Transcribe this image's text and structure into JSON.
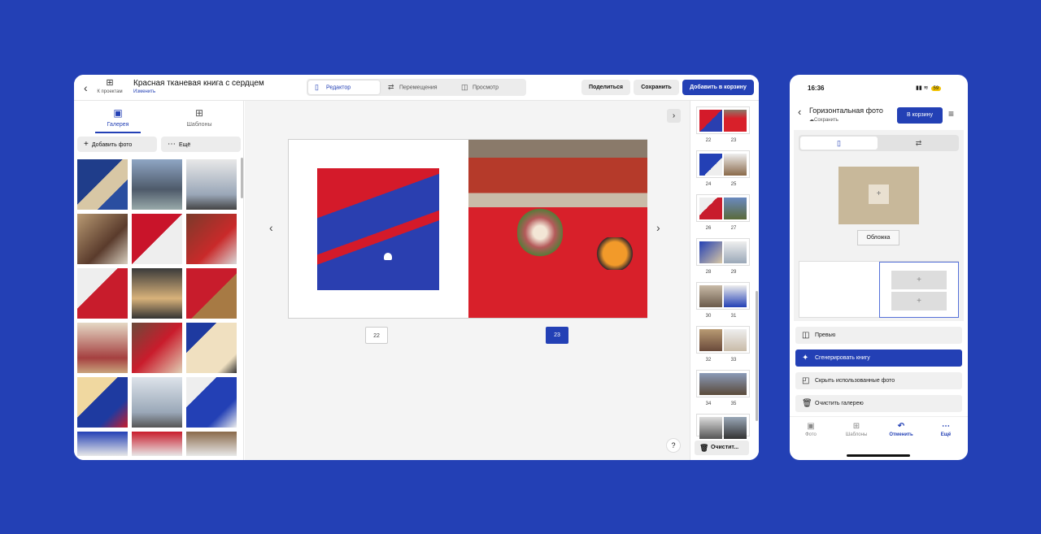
{
  "editor": {
    "back_label": "К проектам",
    "title": "Красная тканевая книга с сердцем",
    "edit_link": "Изменить",
    "modes": [
      "Редактор",
      "Перемещения",
      "Просмотр"
    ],
    "share_label": "Поделиться",
    "save_label": "Сохранить",
    "add_to_cart_label": "Добавить в корзину",
    "left_tabs": [
      "Галерея",
      "Шаблоны"
    ],
    "add_photo_label": "Добавить фото",
    "more_label": "Ещё",
    "pages": [
      "22",
      "23"
    ],
    "thumb_numbers": [
      "22",
      "23",
      "24",
      "25",
      "26",
      "27",
      "28",
      "29",
      "30",
      "31",
      "32",
      "33",
      "34",
      "35"
    ],
    "clear_label": "Очистит...",
    "help_label": "?"
  },
  "phone": {
    "time": "16:36",
    "battery": "59",
    "title": "Горизонтальная фото",
    "saved_label": "Сохранить",
    "cart_label": "В корзину",
    "cover_label": "Обложка",
    "actions": [
      "Превью",
      "Сгенерировать книгу",
      "Скрыть использованные фото",
      "Очистить галерею"
    ],
    "nav": [
      "Фото",
      "Шаблоны",
      "Отменить",
      "Ещё"
    ]
  },
  "colors": {
    "accent": "#2340b5",
    "background": "#2340b5"
  }
}
